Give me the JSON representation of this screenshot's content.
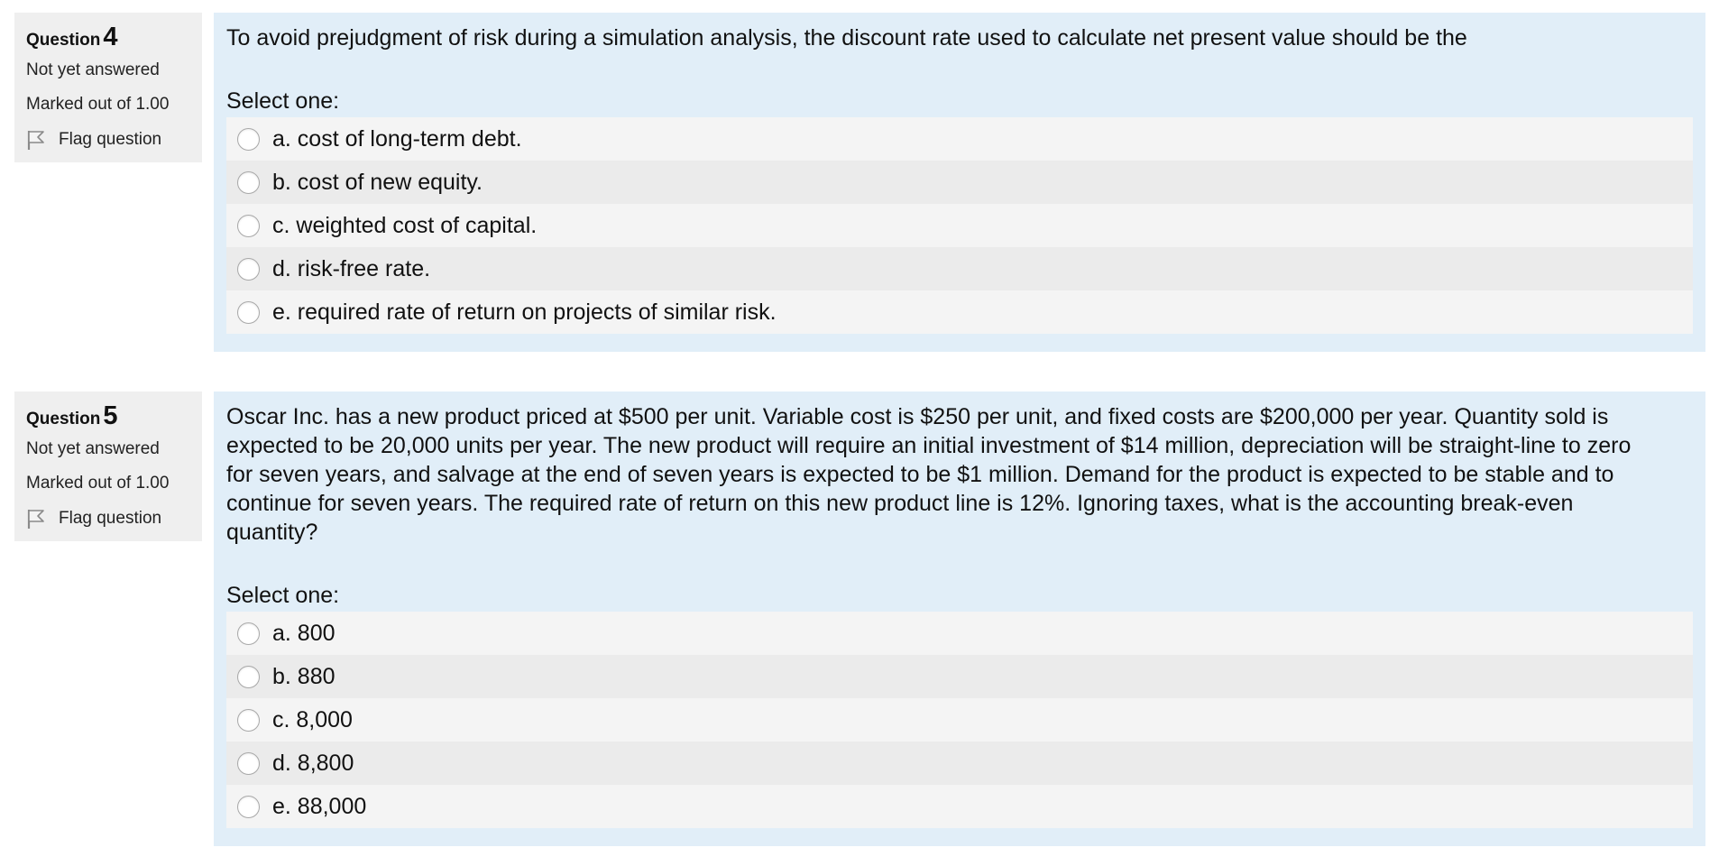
{
  "questions": [
    {
      "label": "Question",
      "number": "4",
      "state": "Not yet answered",
      "grade": "Marked out of 1.00",
      "flag_label": "Flag question",
      "text": "To avoid prejudgment of risk during a simulation analysis, the discount rate used to calculate net present value should be the",
      "prompt": "Select one:",
      "options": [
        "a. cost of long-term debt.",
        "b. cost of new equity.",
        "c. weighted cost of capital.",
        "d. risk-free rate.",
        "e. required rate of return on projects of similar risk."
      ]
    },
    {
      "label": "Question",
      "number": "5",
      "state": "Not yet answered",
      "grade": "Marked out of 1.00",
      "flag_label": "Flag question",
      "text": "Oscar Inc. has a new product priced at $500 per unit. Variable cost is $250 per unit, and fixed costs are $200,000 per year. Quantity sold is expected to be 20,000 units per year. The new product will require an initial investment of $14 million, depreciation will be straight-line to zero for seven years, and salvage at the end of seven years is expected to be $1 million. Demand for the product is expected to be stable and to continue for seven years. The required rate of return on this new product line is 12%. Ignoring taxes, what is the accounting break-even quantity?",
      "prompt": "Select one:",
      "options": [
        "a. 800",
        "b. 880",
        "c. 8,000",
        "d. 8,800",
        "e. 88,000"
      ]
    }
  ],
  "icons": {
    "flag": "flag-icon",
    "radio": "radio-button-unchecked"
  },
  "colors": {
    "info_bg": "#efefef",
    "content_bg": "#e1eef8",
    "option_odd": "#f4f4f4",
    "option_even": "#ebebeb"
  }
}
